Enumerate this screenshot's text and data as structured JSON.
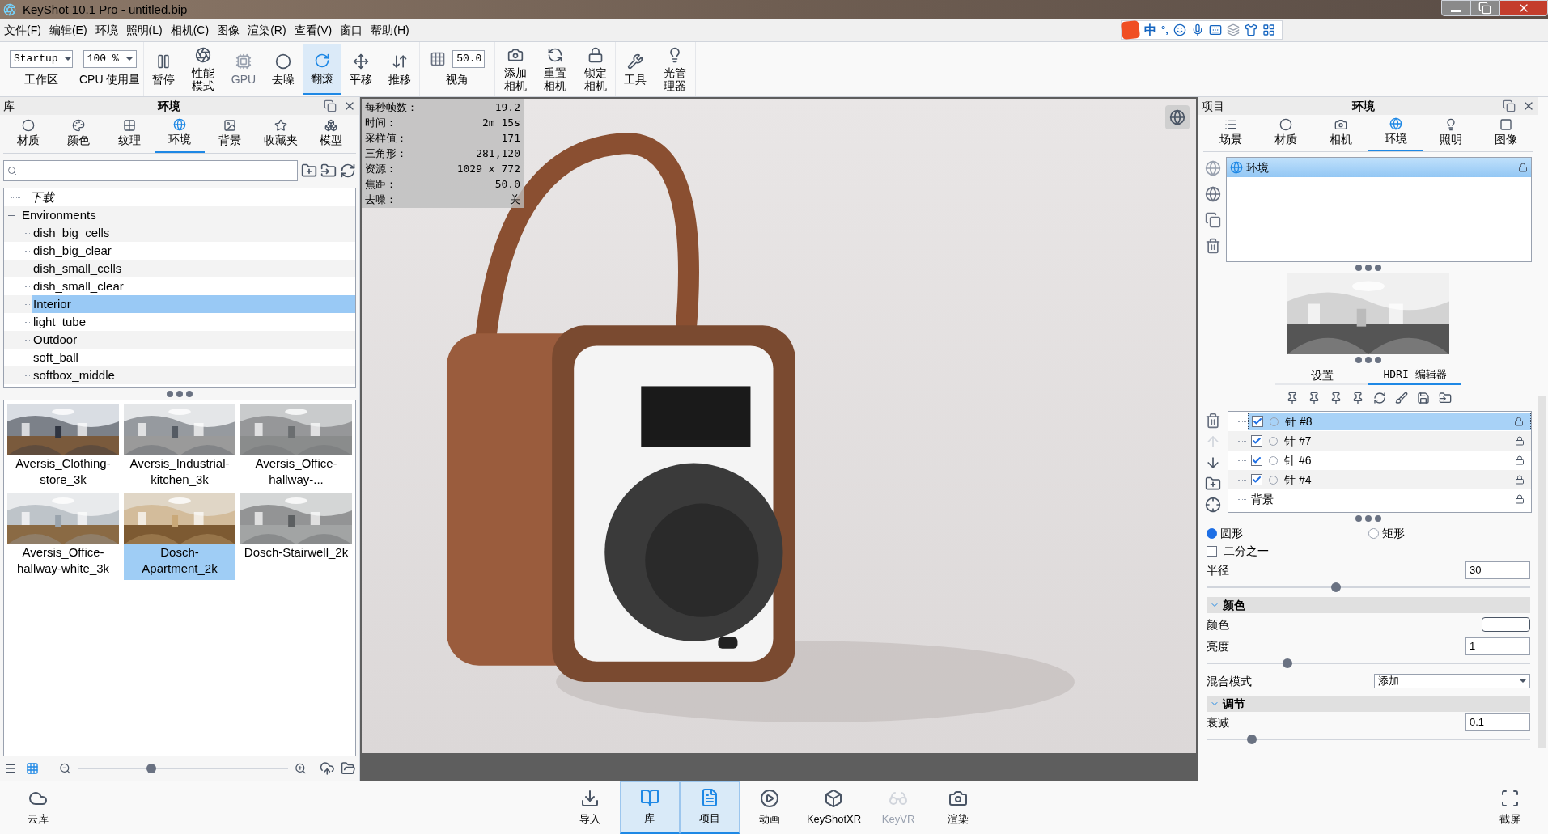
{
  "window": {
    "title": "KeyShot 10.1 Pro  - untitled.bip"
  },
  "menu": [
    "文件(F)",
    "编辑(E)",
    "环境",
    "照明(L)",
    "相机(C)",
    "图像",
    "渲染(R)",
    "查看(V)",
    "窗口",
    "帮助(H)"
  ],
  "ime_bar": {
    "mode": "中",
    "punctuation": "°,"
  },
  "toolbar": [
    {
      "kind": "dropdown",
      "value": "Startup",
      "label": "工作区"
    },
    {
      "kind": "dropdown",
      "value": "100 %",
      "label": "CPU 使用量"
    },
    {
      "kind": "button",
      "label": "暂停",
      "selected": false,
      "disabled": false
    },
    {
      "kind": "button",
      "label": "性能模式",
      "selected": false,
      "disabled": false
    },
    {
      "kind": "button",
      "label": "GPU",
      "selected": false,
      "disabled": true
    },
    {
      "kind": "button",
      "label": "去噪",
      "selected": false,
      "disabled": false
    },
    {
      "kind": "button",
      "label": "翻滚",
      "selected": true,
      "disabled": false
    },
    {
      "kind": "button",
      "label": "平移",
      "selected": false,
      "disabled": false
    },
    {
      "kind": "button",
      "label": "推移",
      "selected": false,
      "disabled": false
    },
    {
      "kind": "field",
      "value": "50.0",
      "label": "视角"
    },
    {
      "kind": "button",
      "label": "添加相机",
      "selected": false,
      "disabled": false
    },
    {
      "kind": "button",
      "label": "重置相机",
      "selected": false,
      "disabled": false
    },
    {
      "kind": "button",
      "label": "锁定相机",
      "selected": false,
      "disabled": false
    },
    {
      "kind": "button",
      "label": "工具",
      "selected": false,
      "disabled": false
    },
    {
      "kind": "button",
      "label": "光管理器",
      "selected": false,
      "disabled": false
    }
  ],
  "library": {
    "header": "库",
    "title": "环境",
    "tabs": [
      {
        "label": "材质",
        "selected": false
      },
      {
        "label": "颜色",
        "selected": false
      },
      {
        "label": "纹理",
        "selected": false
      },
      {
        "label": "环境",
        "selected": true
      },
      {
        "label": "背景",
        "selected": false
      },
      {
        "label": "收藏夹",
        "selected": false
      },
      {
        "label": "模型",
        "selected": false
      }
    ],
    "tree": [
      {
        "kind": "download",
        "label": "下载"
      },
      {
        "kind": "folder",
        "label": "Environments",
        "expanded": true,
        "children": [
          {
            "label": "dish_big_cells",
            "selected": false
          },
          {
            "label": "dish_big_clear",
            "selected": false
          },
          {
            "label": "dish_small_cells",
            "selected": false
          },
          {
            "label": "dish_small_clear",
            "selected": false
          },
          {
            "label": "Interior",
            "selected": true
          },
          {
            "label": "light_tube",
            "selected": false
          },
          {
            "label": "Outdoor",
            "selected": false
          },
          {
            "label": "soft_ball",
            "selected": false
          },
          {
            "label": "softbox_middle",
            "selected": false
          }
        ]
      }
    ],
    "thumbnails": [
      {
        "name": "Aversis_Clothing-store_3k",
        "selected": false
      },
      {
        "name": "Aversis_Industrial-kitchen_3k",
        "selected": false
      },
      {
        "name": "Aversis_Office-hallway-...",
        "selected": false
      },
      {
        "name": "Aversis_Office-hallway-white_3k",
        "selected": false
      },
      {
        "name": "Dosch-Apartment_2k",
        "selected": true
      },
      {
        "name": "Dosch-Stairwell_2k",
        "selected": false
      }
    ],
    "views": [
      {
        "kind": "list",
        "selected": false
      },
      {
        "kind": "grid",
        "selected": true
      }
    ],
    "zoom": {
      "level": 0.35
    }
  },
  "viewport": {
    "stats": [
      {
        "label": "每秒帧数：",
        "value": "19.2"
      },
      {
        "label": "时间：",
        "value": "2m 15s"
      },
      {
        "label": "采样值：",
        "value": "171"
      },
      {
        "label": "三角形：",
        "value": "281,120"
      },
      {
        "label": "资源：",
        "value": "1029 x 772"
      },
      {
        "label": "焦距：",
        "value": "50.0"
      },
      {
        "label": "去噪：",
        "value": "关"
      }
    ]
  },
  "project": {
    "header": "项目",
    "title": "环境",
    "tabs": [
      {
        "label": "场景",
        "selected": false
      },
      {
        "label": "材质",
        "selected": false
      },
      {
        "label": "相机",
        "selected": false
      },
      {
        "label": "环境",
        "selected": true
      },
      {
        "label": "照明",
        "selected": false
      },
      {
        "label": "图像",
        "selected": false
      }
    ],
    "environments": [
      {
        "label": "环境",
        "selected": true
      }
    ],
    "editor_tabs": [
      {
        "label": "设置",
        "selected": false
      },
      {
        "label": "HDRI 编辑器",
        "selected": true
      }
    ],
    "pins": [
      {
        "kind": "pin",
        "label": "针 #8",
        "checked": true,
        "selected": true
      },
      {
        "kind": "pin",
        "label": "针 #7",
        "checked": true,
        "selected": false
      },
      {
        "kind": "pin",
        "label": "针 #6",
        "checked": true,
        "selected": false
      },
      {
        "kind": "pin",
        "label": "针 #4",
        "checked": true,
        "selected": false
      },
      {
        "kind": "background",
        "label": "背景",
        "selected": false
      }
    ],
    "shapes": [
      {
        "label": "圆形",
        "selected": true
      },
      {
        "label": "矩形",
        "selected": false
      }
    ],
    "half": {
      "label": "二分之一",
      "checked": false
    },
    "radius": {
      "label": "半径",
      "value": "30",
      "level": 0.4
    },
    "sections": [
      {
        "title": "颜色",
        "expanded": true,
        "rows": [
          {
            "kind": "color",
            "label": "颜色",
            "color": "#ffffff"
          },
          {
            "kind": "slider",
            "label": "亮度",
            "value": "1",
            "level": 0.25
          },
          {
            "kind": "dropdown",
            "label": "混合模式",
            "value": "添加"
          }
        ]
      },
      {
        "title": "调节",
        "expanded": true,
        "rows": [
          {
            "kind": "slider",
            "label": "衰减",
            "value": "0.1",
            "level": 0.14
          }
        ]
      }
    ]
  },
  "bottom_bar": {
    "left": [
      {
        "label": "云库",
        "selected": false,
        "disabled": false
      }
    ],
    "center": [
      {
        "label": "导入",
        "selected": false,
        "disabled": false
      },
      {
        "label": "库",
        "selected": true,
        "disabled": false
      },
      {
        "label": "项目",
        "selected": true,
        "disabled": false
      },
      {
        "label": "动画",
        "selected": false,
        "disabled": false
      },
      {
        "label": "KeyShotXR",
        "selected": false,
        "disabled": false
      },
      {
        "label": "KeyVR",
        "selected": false,
        "disabled": true
      },
      {
        "label": "渲染",
        "selected": false,
        "disabled": false
      }
    ],
    "right": [
      {
        "label": "截屏",
        "selected": false,
        "disabled": false
      }
    ]
  }
}
